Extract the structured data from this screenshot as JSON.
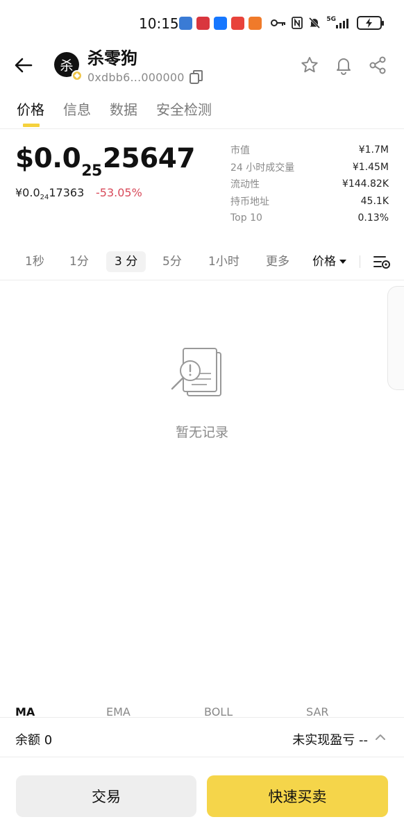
{
  "status_bar": {
    "time": "10:15",
    "network": "5G",
    "app_colors": [
      "#3a7bd5",
      "#d9363e",
      "#1677ff",
      "#e8433b",
      "#f07a2a"
    ]
  },
  "header": {
    "token_avatar_char": "杀",
    "token_name": "杀零狗",
    "token_address": "0xdbb6...000000"
  },
  "tabs": [
    {
      "label": "价格",
      "active": true
    },
    {
      "label": "信息",
      "active": false
    },
    {
      "label": "数据",
      "active": false
    },
    {
      "label": "安全检测",
      "active": false
    }
  ],
  "price": {
    "main_prefix": "$0.0",
    "main_sub": "25",
    "main_suffix": "25647",
    "cny_prefix": "¥0.0",
    "cny_sub": "24",
    "cny_suffix": "17363",
    "change": "-53.05%"
  },
  "stats": [
    {
      "label": "市值",
      "value": "¥1.7M"
    },
    {
      "label": "24 小时成交量",
      "value": "¥1.45M"
    },
    {
      "label": "流动性",
      "value": "¥144.82K"
    },
    {
      "label": "持币地址",
      "value": "45.1K"
    },
    {
      "label": "Top 10",
      "value": "0.13%"
    }
  ],
  "timeframes": {
    "t1s": "1秒",
    "t1m": "1分",
    "t3m": "3 分",
    "t5m": "5分",
    "t1h": "1小时",
    "more": "更多",
    "price": "价格"
  },
  "chart": {
    "empty_text": "暂无记录"
  },
  "indicators": [
    "MA",
    "EMA",
    "BOLL",
    "SAR"
  ],
  "balance": {
    "label": "余额 0",
    "pnl": "未实现盈亏 --"
  },
  "actions": {
    "trade": "交易",
    "quick_trade": "快速买卖"
  },
  "colors": {
    "accent_yellow": "#f5d54a",
    "negative_red": "#d84a5a"
  }
}
